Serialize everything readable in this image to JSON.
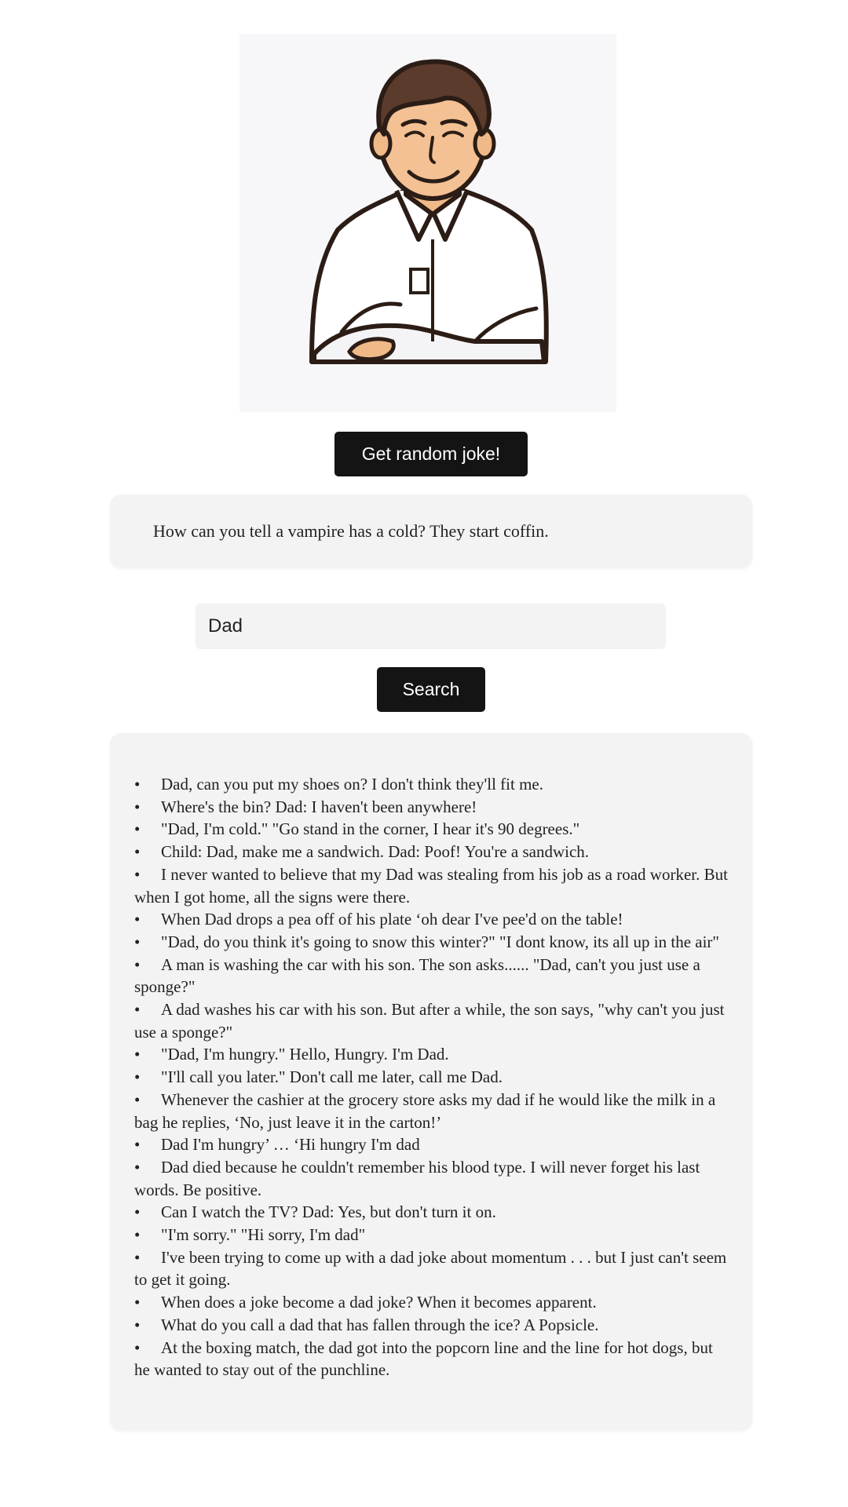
{
  "hero": {
    "icon": "dad-character-illustration"
  },
  "random_button": {
    "label": "Get random joke!"
  },
  "current_joke": "How can you tell a vampire has a cold? They start coffin.",
  "search": {
    "value": "Dad",
    "placeholder": ""
  },
  "search_button": {
    "label": "Search"
  },
  "results": [
    "Dad, can you put my shoes on? I don't think they'll fit me.",
    "Where's the bin? Dad: I haven't been anywhere!",
    "\"Dad, I'm cold.\" \"Go stand in the corner, I hear it's 90 degrees.\"",
    "Child: Dad, make me a sandwich. Dad: Poof! You're a sandwich.",
    "I never wanted to believe that my Dad was stealing from his job as a road worker. But when I got home, all the signs were there.",
    "When Dad drops a pea off of his plate ‘oh dear I've pee'd on the table!",
    "\"Dad, do you think it's going to snow this winter?\" \"I dont know, its all up in the air\"",
    "A man is washing the car with his son. The son asks...... \"Dad, can't you just use a sponge?\"",
    "A dad washes his car with his son. But after a while, the son says, \"why can't you just use a sponge?\"",
    "\"Dad, I'm hungry.\" Hello, Hungry. I'm Dad.",
    "\"I'll call you later.\" Don't call me later, call me Dad.",
    "Whenever the cashier at the grocery store asks my dad if he would like the milk in a bag he replies, ‘No, just leave it in the carton!’",
    "Dad I'm hungry’ … ‘Hi hungry I'm dad",
    "Dad died because he couldn't remember his blood type. I will never forget his last words. Be positive.",
    "Can I watch the TV? Dad: Yes, but don't turn it on.",
    "\"I'm sorry.\" \"Hi sorry, I'm dad\"",
    "I've been trying to come up with a dad joke about momentum . . . but I just can't seem to get it going.",
    "When does a joke become a dad joke? When it becomes apparent.",
    "What do you call a dad that has fallen through the ice? A Popsicle.",
    "At the boxing match, the dad got into the popcorn line and the line for hot dogs, but he wanted to stay out of the punchline."
  ]
}
